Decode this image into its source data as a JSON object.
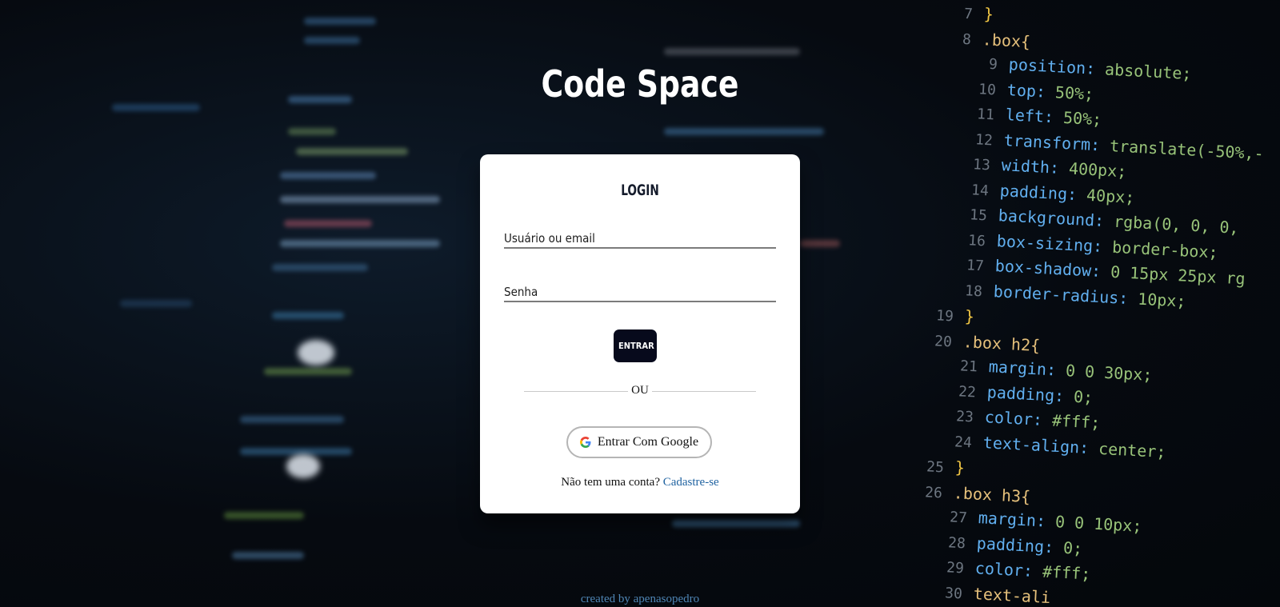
{
  "app": {
    "title": "Code Space"
  },
  "login": {
    "heading": "LOGIN",
    "username_placeholder": "Usuário ou email",
    "password_placeholder": "Senha",
    "submit_label": "ENTRAR",
    "divider_text": "OU",
    "google_label": "Entrar Com Google",
    "signup_prompt": "Não tem uma conta?",
    "signup_link": "Cadastre-se"
  },
  "footer": {
    "credit": "created by apenasopedro"
  },
  "background_code": {
    "lines": [
      {
        "n": "7",
        "t": "}"
      },
      {
        "n": "8",
        "t": ".box{"
      },
      {
        "n": "9",
        "t": "position: absolute;"
      },
      {
        "n": "10",
        "t": "top: 50%;"
      },
      {
        "n": "11",
        "t": "left: 50%;"
      },
      {
        "n": "12",
        "t": "transform: translate(-50%,-"
      },
      {
        "n": "13",
        "t": "width: 400px;"
      },
      {
        "n": "14",
        "t": "padding: 40px;"
      },
      {
        "n": "15",
        "t": "background: rgba(0, 0, 0,"
      },
      {
        "n": "16",
        "t": "box-sizing: border-box;"
      },
      {
        "n": "17",
        "t": "box-shadow: 0 15px 25px rg"
      },
      {
        "n": "18",
        "t": "border-radius: 10px;"
      },
      {
        "n": "19",
        "t": "}"
      },
      {
        "n": "20",
        "t": ".box h2{"
      },
      {
        "n": "21",
        "t": "margin: 0 0 30px;"
      },
      {
        "n": "22",
        "t": "padding: 0;"
      },
      {
        "n": "23",
        "t": "color: #fff;"
      },
      {
        "n": "24",
        "t": "text-align: center;"
      },
      {
        "n": "25",
        "t": "}"
      },
      {
        "n": "26",
        "t": ".box h3{"
      },
      {
        "n": "27",
        "t": "margin: 0 0 10px;"
      },
      {
        "n": "28",
        "t": "padding: 0;"
      },
      {
        "n": "29",
        "t": "color: #fff;"
      },
      {
        "n": "30",
        "t": "text-ali"
      }
    ]
  },
  "colors": {
    "button_bg": "#070a1c",
    "link": "#1f62a0",
    "footer_text": "#4f86b5",
    "card_bg": "#ffffff"
  },
  "icons": {
    "google": "google-icon"
  }
}
